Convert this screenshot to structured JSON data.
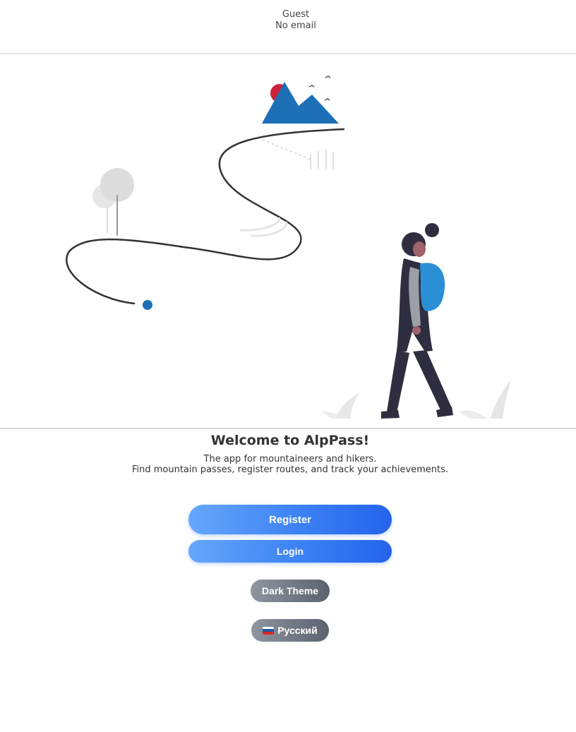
{
  "header": {
    "user_name": "Guest",
    "user_email": "No email"
  },
  "welcome": {
    "title": "Welcome to AlpPass!",
    "line1": "The app for mountaineers and hikers.",
    "line2": "Find mountain passes, register routes, and track your achievements."
  },
  "actions": {
    "register_label": "Register",
    "login_label": "Login",
    "theme_label": "Dark Theme",
    "language_label": "Русский",
    "language_flag_icon": "russia-flag-icon"
  },
  "colors": {
    "primary_gradient_start": "#66a7fb",
    "primary_gradient_end": "#2563eb",
    "secondary_gradient_start": "#8e95a0",
    "secondary_gradient_end": "#5b6270",
    "accent_blue": "#2271b8",
    "accent_red": "#d0223a",
    "dark_figure": "#2f2e41"
  }
}
